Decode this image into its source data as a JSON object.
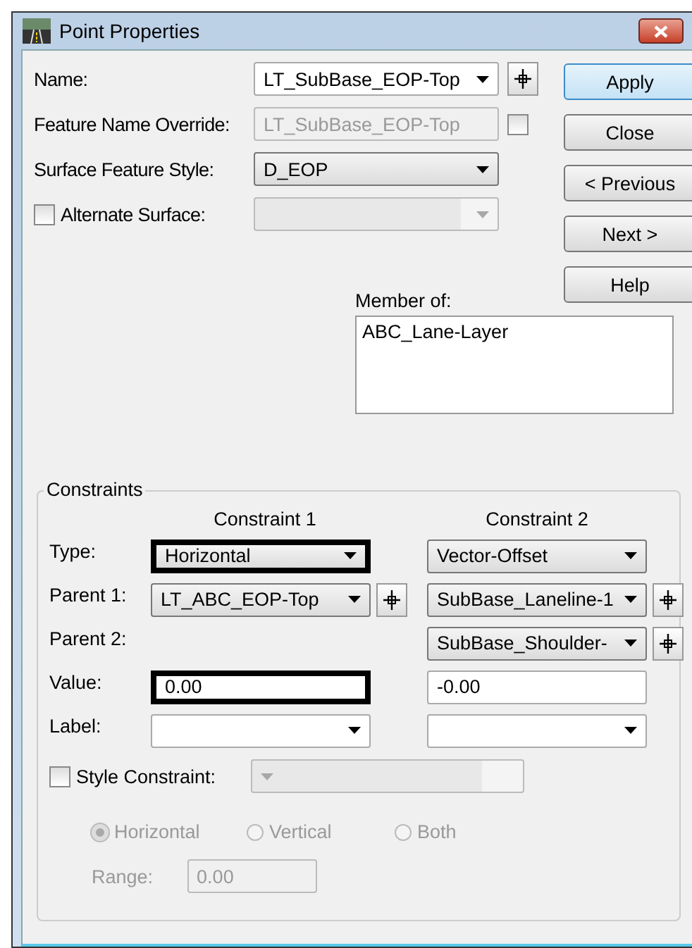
{
  "window": {
    "title": "Point Properties"
  },
  "fields": [
    {
      "label": "Name:",
      "kind": "combo",
      "value": "LT_SubBase_EOP-Top",
      "disabled": false,
      "pick": true
    },
    {
      "label": "Feature Name Override:",
      "kind": "text",
      "value": "LT_SubBase_EOP-Top",
      "disabled": true,
      "checkbox": {
        "checked": false
      }
    },
    {
      "label": "Surface Feature Style:",
      "kind": "dropdown",
      "value": "D_EOP",
      "disabled": false
    },
    {
      "label": "Alternate Surface:",
      "kind": "combo",
      "disabled": true,
      "label_checkbox": {
        "checked": false
      }
    }
  ],
  "buttons": [
    {
      "label": "Apply",
      "default": true
    },
    {
      "label": "Close",
      "default": false
    },
    {
      "label": "< Previous",
      "default": false
    },
    {
      "label": "Next >",
      "default": false
    },
    {
      "label": "Help",
      "default": false
    }
  ],
  "member_of": {
    "label": "Member of:",
    "items": [
      "ABC_Lane-Layer"
    ]
  },
  "constraints": {
    "title": "Constraints",
    "columns": [
      "Constraint 1",
      "Constraint 2"
    ],
    "rows": [
      {
        "label": "Type:",
        "cells": [
          {
            "kind": "dropdown",
            "value": "Horizontal",
            "highlighted": true
          },
          {
            "kind": "dropdown",
            "value": "Vector-Offset",
            "highlighted": false
          }
        ]
      },
      {
        "label": "Parent 1:",
        "cells": [
          {
            "kind": "dropdown",
            "value": "LT_ABC_EOP-Top",
            "highlighted": false,
            "pick": true
          },
          {
            "kind": "dropdown",
            "value": "SubBase_Laneline-1",
            "highlighted": false,
            "pick": true
          }
        ]
      },
      {
        "label": "Parent 2:",
        "cells": [
          {
            "kind": "none"
          },
          {
            "kind": "dropdown",
            "value": "SubBase_Shoulder-",
            "highlighted": false,
            "pick": true
          }
        ]
      },
      {
        "label": "Value:",
        "cells": [
          {
            "kind": "text",
            "value": "0.00",
            "highlighted": true
          },
          {
            "kind": "text",
            "value": "-0.00",
            "highlighted": false
          }
        ]
      },
      {
        "label": "Label:",
        "cells": [
          {
            "kind": "combo",
            "highlighted": false
          },
          {
            "kind": "combo",
            "highlighted": false
          }
        ]
      }
    ],
    "style_constraint": {
      "label": "Style Constraint:",
      "checked": false,
      "disabled": true
    },
    "directions": [
      {
        "label": "Horizontal",
        "selected": true,
        "disabled": true
      },
      {
        "label": "Vertical",
        "selected": false,
        "disabled": true
      },
      {
        "label": "Both",
        "selected": false,
        "disabled": true
      }
    ],
    "range": {
      "label": "Range:",
      "value": "0.00",
      "disabled": true
    }
  }
}
